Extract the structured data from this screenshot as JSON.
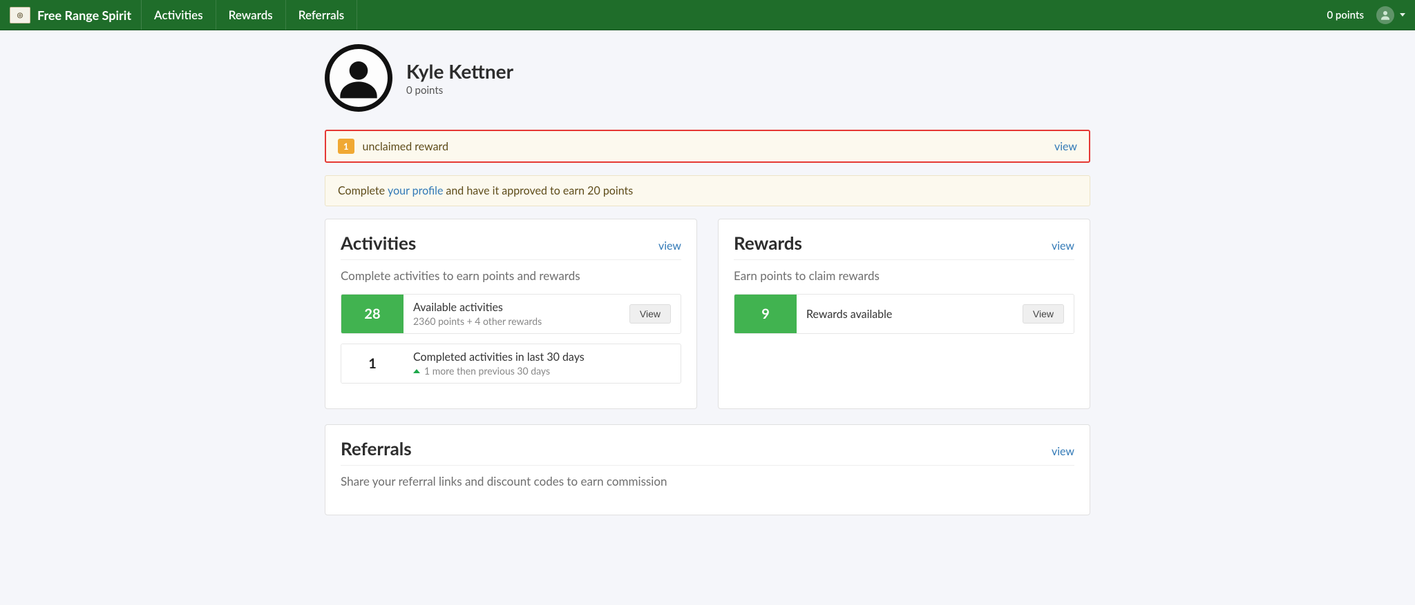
{
  "nav": {
    "brand": "Free Range Spirit",
    "links": [
      "Activities",
      "Rewards",
      "Referrals"
    ],
    "points_label": "0 points"
  },
  "profile": {
    "name": "Kyle Kettner",
    "points_label": "0 points"
  },
  "unclaimed": {
    "count": "1",
    "text": "unclaimed reward",
    "view": "view"
  },
  "complete_profile": {
    "prefix": "Complete ",
    "link": "your profile",
    "suffix": " and have it approved to earn 20 points"
  },
  "activities": {
    "title": "Activities",
    "view": "view",
    "subtitle": "Complete activities to earn points and rewards",
    "available": {
      "count": "28",
      "title": "Available activities",
      "sub": "2360 points + 4 other rewards",
      "button": "View"
    },
    "completed": {
      "count": "1",
      "title": "Completed activities in last 30 days",
      "sub": "1 more then previous 30 days"
    }
  },
  "rewards": {
    "title": "Rewards",
    "view": "view",
    "subtitle": "Earn points to claim rewards",
    "available": {
      "count": "9",
      "title": "Rewards available",
      "button": "View"
    }
  },
  "referrals": {
    "title": "Referrals",
    "view": "view",
    "subtitle": "Share your referral links and discount codes to earn commission"
  }
}
